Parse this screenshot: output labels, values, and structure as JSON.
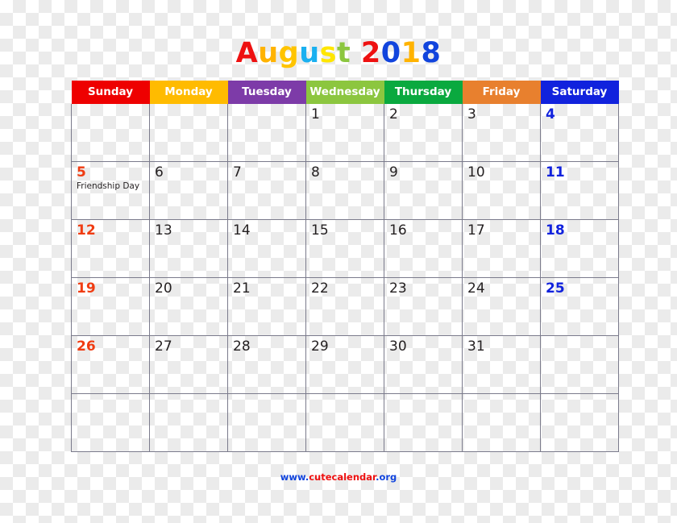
{
  "title": {
    "text": "August 2018",
    "month": "August",
    "year": "2018",
    "letters": [
      {
        "ch": "A",
        "color": "#ee1111"
      },
      {
        "ch": "u",
        "color": "#ffb300"
      },
      {
        "ch": "g",
        "color": "#ffc400"
      },
      {
        "ch": "u",
        "color": "#1ab0f0"
      },
      {
        "ch": "s",
        "color": "#ffe600"
      },
      {
        "ch": "t",
        "color": "#8cc63f"
      },
      {
        "ch": " ",
        "color": "#000000"
      },
      {
        "ch": "2",
        "color": "#ee1111"
      },
      {
        "ch": "0",
        "color": "#1144dd"
      },
      {
        "ch": "1",
        "color": "#ffb300"
      },
      {
        "ch": "8",
        "color": "#1144dd"
      }
    ]
  },
  "weekdays": [
    {
      "label": "Sunday",
      "color": "#ee0000"
    },
    {
      "label": "Monday",
      "color": "#ffbb00"
    },
    {
      "label": "Tuesday",
      "color": "#7d3ba8"
    },
    {
      "label": "Wednesday",
      "color": "#8cc63f"
    },
    {
      "label": "Thursday",
      "color": "#0aa93f"
    },
    {
      "label": "Friday",
      "color": "#e8802e"
    },
    {
      "label": "Saturday",
      "color": "#1122dd"
    }
  ],
  "colors": {
    "sunday_date": "#f03c12",
    "saturday_date": "#1122dd",
    "weekday_date": "#231f20",
    "grid_line": "#7b7b8c",
    "footer_blue": "#1144dd",
    "footer_red": "#ee1111"
  },
  "weeks": [
    [
      {
        "date": "",
        "event": "",
        "kind": "sun"
      },
      {
        "date": "",
        "event": "",
        "kind": "week"
      },
      {
        "date": "",
        "event": "",
        "kind": "week"
      },
      {
        "date": "1",
        "event": "",
        "kind": "week"
      },
      {
        "date": "2",
        "event": "",
        "kind": "week"
      },
      {
        "date": "3",
        "event": "",
        "kind": "week"
      },
      {
        "date": "4",
        "event": "",
        "kind": "sat"
      }
    ],
    [
      {
        "date": "5",
        "event": "Friendship Day",
        "kind": "sun"
      },
      {
        "date": "6",
        "event": "",
        "kind": "week"
      },
      {
        "date": "7",
        "event": "",
        "kind": "week"
      },
      {
        "date": "8",
        "event": "",
        "kind": "week"
      },
      {
        "date": "9",
        "event": "",
        "kind": "week"
      },
      {
        "date": "10",
        "event": "",
        "kind": "week"
      },
      {
        "date": "11",
        "event": "",
        "kind": "sat"
      }
    ],
    [
      {
        "date": "12",
        "event": "",
        "kind": "sun"
      },
      {
        "date": "13",
        "event": "",
        "kind": "week"
      },
      {
        "date": "14",
        "event": "",
        "kind": "week"
      },
      {
        "date": "15",
        "event": "",
        "kind": "week"
      },
      {
        "date": "16",
        "event": "",
        "kind": "week"
      },
      {
        "date": "17",
        "event": "",
        "kind": "week"
      },
      {
        "date": "18",
        "event": "",
        "kind": "sat"
      }
    ],
    [
      {
        "date": "19",
        "event": "",
        "kind": "sun"
      },
      {
        "date": "20",
        "event": "",
        "kind": "week"
      },
      {
        "date": "21",
        "event": "",
        "kind": "week"
      },
      {
        "date": "22",
        "event": "",
        "kind": "week"
      },
      {
        "date": "23",
        "event": "",
        "kind": "week"
      },
      {
        "date": "24",
        "event": "",
        "kind": "week"
      },
      {
        "date": "25",
        "event": "",
        "kind": "sat"
      }
    ],
    [
      {
        "date": "26",
        "event": "",
        "kind": "sun"
      },
      {
        "date": "27",
        "event": "",
        "kind": "week"
      },
      {
        "date": "28",
        "event": "",
        "kind": "week"
      },
      {
        "date": "29",
        "event": "",
        "kind": "week"
      },
      {
        "date": "30",
        "event": "",
        "kind": "week"
      },
      {
        "date": "31",
        "event": "",
        "kind": "week"
      },
      {
        "date": "",
        "event": "",
        "kind": "sat"
      }
    ],
    [
      {
        "date": "",
        "event": "",
        "kind": "sun"
      },
      {
        "date": "",
        "event": "",
        "kind": "week"
      },
      {
        "date": "",
        "event": "",
        "kind": "week"
      },
      {
        "date": "",
        "event": "",
        "kind": "week"
      },
      {
        "date": "",
        "event": "",
        "kind": "week"
      },
      {
        "date": "",
        "event": "",
        "kind": "week"
      },
      {
        "date": "",
        "event": "",
        "kind": "sat"
      }
    ]
  ],
  "footer": {
    "text": "www.cutecalendar.org",
    "segments": [
      {
        "text": "www.",
        "color": "#1144dd"
      },
      {
        "text": "cutecalendar",
        "color": "#ee1111"
      },
      {
        "text": ".org",
        "color": "#1144dd"
      }
    ]
  }
}
